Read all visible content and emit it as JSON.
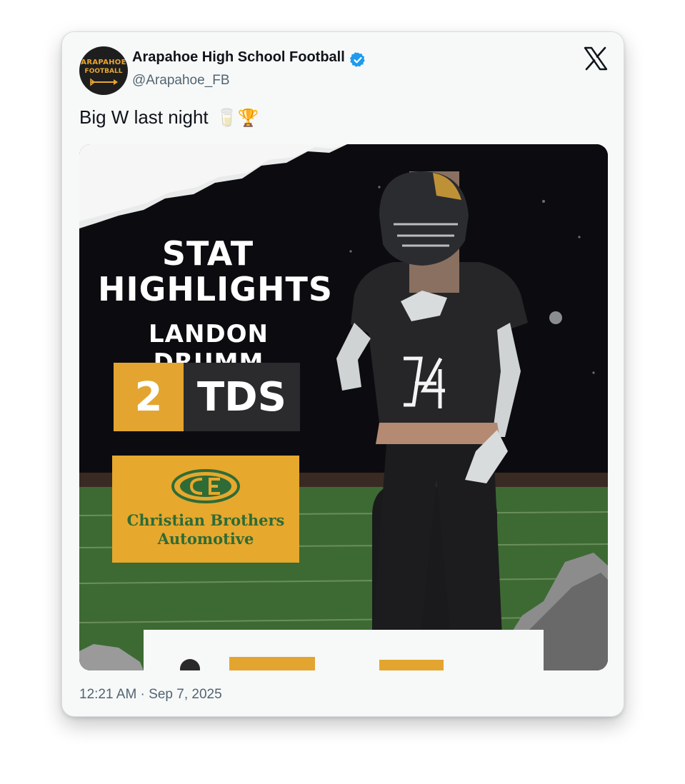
{
  "post": {
    "display_name": "Arapahoe High School Football",
    "handle": "@Arapahoe_FB",
    "verified": true,
    "text": "Big W last night",
    "emojis": "🥛🏆",
    "timestamp": "12:21 AM · Sep 7, 2025"
  },
  "avatar": {
    "line1": "ARAPAHOE",
    "line2": "FOOTBALL"
  },
  "icons": {
    "verified": "verified-badge-icon",
    "platform": "x-logo-icon"
  },
  "media": {
    "title_line1": "STAT",
    "title_line2": "HIGHLIGHTS",
    "player_name": "LANDON DRUMM",
    "stat_value": "2",
    "stat_label": "TDS",
    "jersey_number": "14",
    "sponsor_line1": "Christian Brothers",
    "sponsor_line2": "Automotive"
  },
  "colors": {
    "accent_gold": "#e3a530",
    "verified_blue": "#1d9bf0",
    "sponsor_green": "#2f6b36",
    "text_primary": "#0f1419",
    "text_secondary": "#536471"
  }
}
